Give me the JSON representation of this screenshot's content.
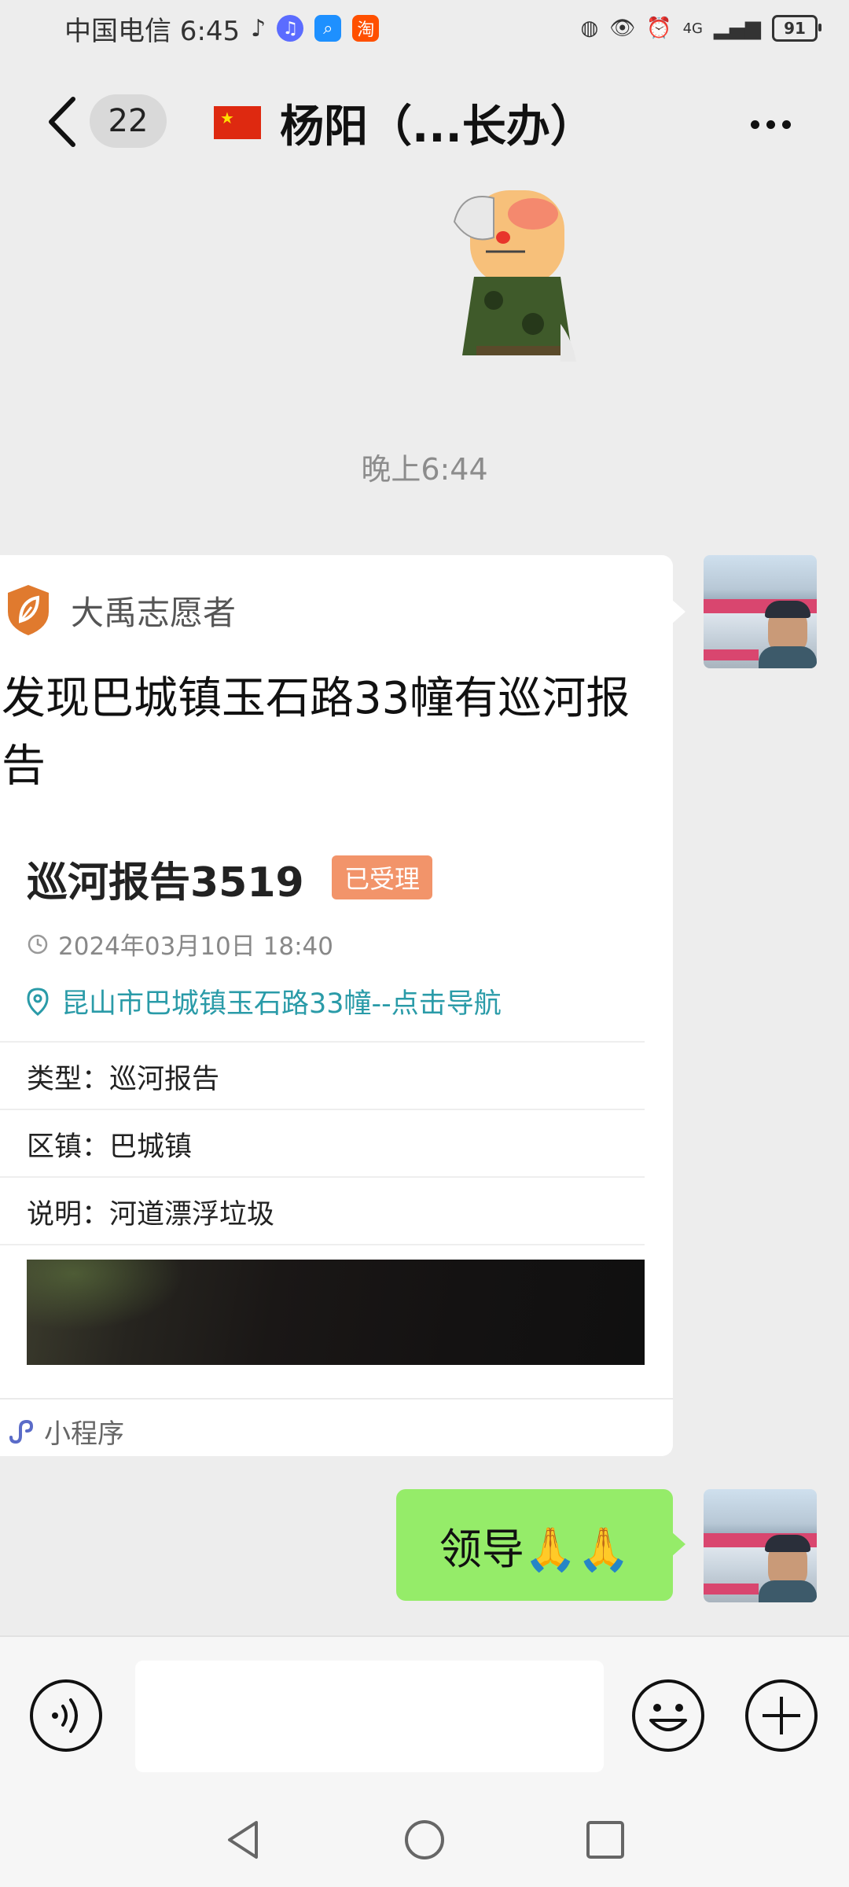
{
  "status_bar": {
    "carrier_time": "中国电信 6:45",
    "taobao_glyph": "淘",
    "network": "4G",
    "battery": "91"
  },
  "header": {
    "unread_count": "22",
    "title": "杨阳（...长办）",
    "flag": "china-flag-icon"
  },
  "chat": {
    "timestamp": "晚上6:44",
    "card": {
      "source_name": "大禹志愿者",
      "headline": "发现巴城镇玉石路33幢有巡河报告",
      "report_title": "巡河报告3519",
      "status": "已受理",
      "datetime": "2024年03月10日 18:40",
      "location": "昆山市巴城镇玉石路33幢--点击导航",
      "fields": [
        {
          "label": "类型：",
          "value": "巡河报告"
        },
        {
          "label": "区镇：",
          "value": "巴城镇"
        },
        {
          "label": "说明：",
          "value": "河道漂浮垃圾"
        }
      ],
      "footer_label": "小程序"
    },
    "sent_message": "领导🙏🙏"
  },
  "colors": {
    "background": "#ededed",
    "sent_bubble": "#95ec69",
    "badge": "#f2946a",
    "location_link": "#2a9ba8",
    "source_logo": "#e07a2e"
  }
}
